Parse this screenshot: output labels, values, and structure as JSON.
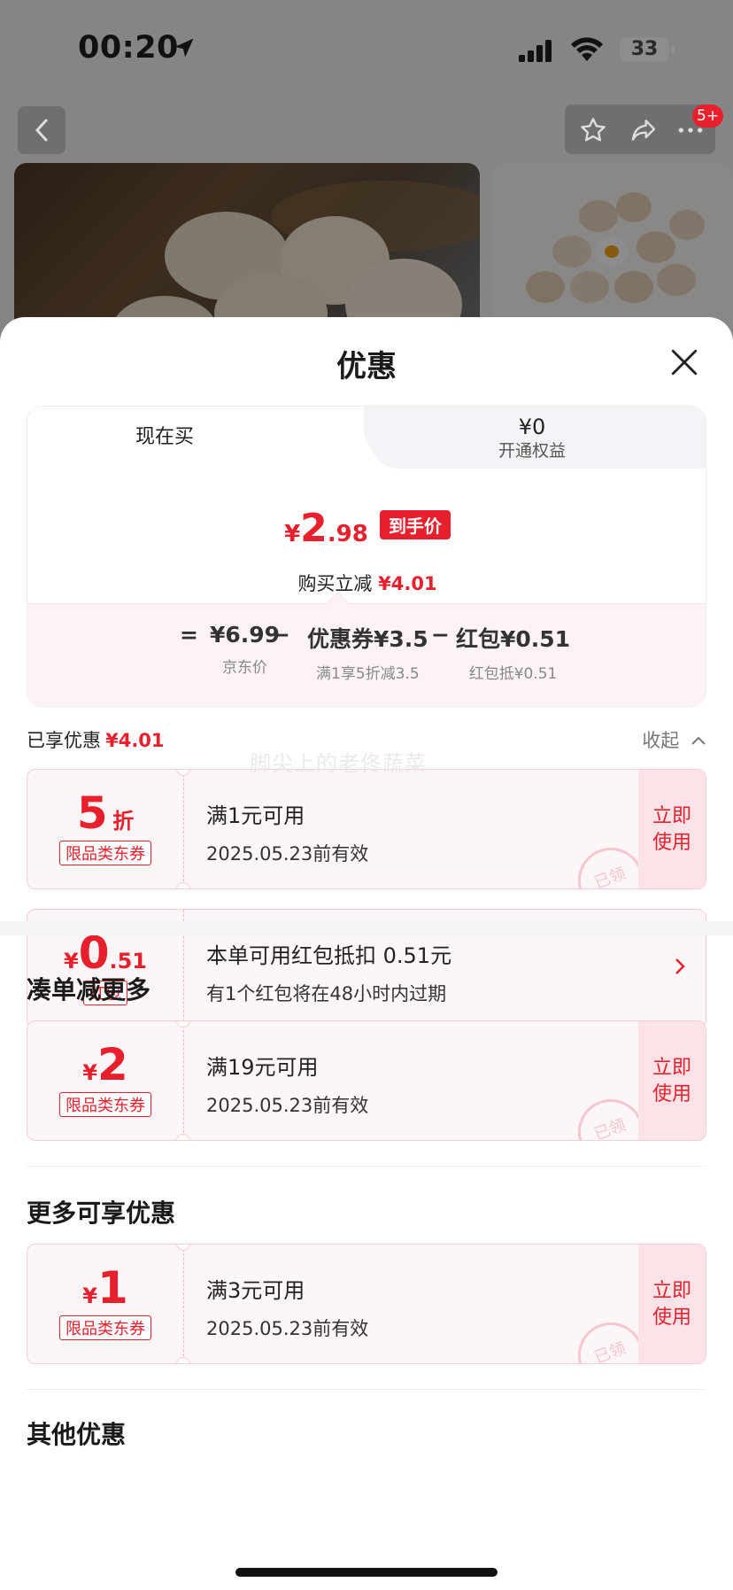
{
  "status_bar": {
    "time": "00:20",
    "battery": "33"
  },
  "background_page": {
    "badge": "5+"
  },
  "sheet": {
    "title": "优惠",
    "tabs": {
      "now": "现在买",
      "member_amount": "¥0",
      "member_label": "开通权益"
    },
    "final_price": {
      "currency": "¥",
      "integer": "2",
      "decimal": ".98",
      "tag": "到手价"
    },
    "instant_save": {
      "label": "购买立减",
      "amount": "¥4.01"
    },
    "formula": {
      "equals": "=",
      "jd_price": "¥6.99",
      "jd_price_label": "京东价",
      "minus1": "−",
      "coupon": "优惠券¥3.5",
      "coupon_label": "满1享5折减3.5",
      "minus2": "−",
      "red_packet": "红包¥0.51",
      "red_packet_label": "红包抵¥0.51"
    },
    "enjoyed": {
      "label": "已享优惠",
      "amount": "¥4.01",
      "collapse": "收起"
    },
    "coupons_enjoyed": [
      {
        "value_big": "5",
        "value_small": "折",
        "tag": "限品类东券",
        "line1": "满1元可用",
        "line2": "2025.05.23前有效",
        "action": "立即使用",
        "stamp": "已领"
      },
      {
        "value_prefix": "¥",
        "value_big": "0",
        "value_small": ".51",
        "tag": "红包",
        "line1": "本单可用红包抵扣 0.51元",
        "line2": "有1个红包将在48小时内过期"
      }
    ],
    "section_more": {
      "title": "凑单减更多",
      "coupon": {
        "value_prefix": "¥",
        "value_big": "2",
        "tag": "限品类东券",
        "line1": "满19元可用",
        "line2": "2025.05.23前有效",
        "action": "立即使用",
        "stamp": "已领"
      }
    },
    "section_extra": {
      "title": "更多可享优惠",
      "coupon": {
        "value_prefix": "¥",
        "value_big": "1",
        "tag": "限品类东券",
        "line1": "满3元可用",
        "line2": "2025.05.23前有效",
        "action": "立即使用",
        "stamp": "已领"
      }
    },
    "section_other": {
      "title": "其他优惠"
    }
  },
  "watermark": "脚尖上的老佟蔬菜",
  "colors": {
    "accent_red": "#e8202d",
    "coupon_bg": "#fdf6f7",
    "coupon_border": "#f7cdd5"
  }
}
